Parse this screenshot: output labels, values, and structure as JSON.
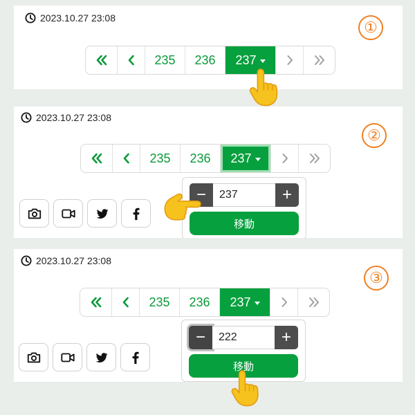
{
  "step_markers": [
    "①",
    "②",
    "③"
  ],
  "panels": [
    {
      "timestamp": "2023.10.27 23:08",
      "pager": {
        "first": "«",
        "prev": "‹",
        "pages": [
          "235",
          "236"
        ],
        "current": "237",
        "next": "›",
        "last": "»"
      }
    },
    {
      "timestamp": "2023.10.27 23:08",
      "pager": {
        "first": "«",
        "prev": "‹",
        "pages": [
          "235",
          "236"
        ],
        "current": "237",
        "next": "›",
        "last": "»"
      },
      "jump": {
        "minus": "−",
        "value": "237",
        "plus": "+",
        "move_label": "移動"
      }
    },
    {
      "timestamp": "2023.10.27 23:08",
      "pager": {
        "first": "«",
        "prev": "‹",
        "pages": [
          "235",
          "236"
        ],
        "current": "237",
        "next": "›",
        "last": "»"
      },
      "jump": {
        "minus": "−",
        "value": "222",
        "plus": "+",
        "move_label": "移動"
      }
    }
  ],
  "share_icons": [
    "camera-icon",
    "video-icon",
    "twitter-icon",
    "facebook-icon"
  ],
  "colors": {
    "accent": "#07a03e",
    "step_marker": "#f07f1f",
    "stepper": "#4d4d4d",
    "background": "#eaeeeb"
  }
}
